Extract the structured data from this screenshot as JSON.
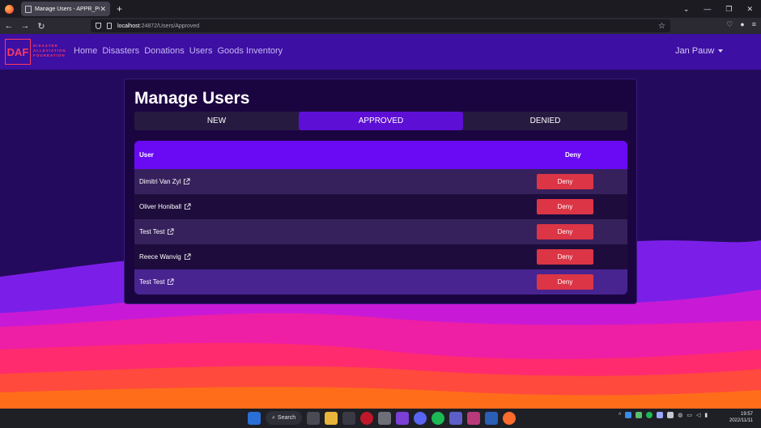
{
  "browser": {
    "tab_title": "Manage Users - APPR_POE",
    "tab_close": "✕",
    "new_tab": "+",
    "url_host": "localhost",
    "url_path": ":24872/Users/Approved",
    "window_controls": [
      "⌄",
      "—",
      "❐",
      "✕"
    ],
    "nav_buttons": [
      "←",
      "→",
      "↻"
    ],
    "toolbar_icons": [
      "shield-icon",
      "account-icon",
      "menu-icon"
    ]
  },
  "site": {
    "logo_text": "DAF",
    "logo_sub": [
      "DISASTER",
      "ALLEVIATION",
      "FOUNDATION"
    ],
    "menu": [
      "Home",
      "Disasters",
      "Donations",
      "Users",
      "Goods Inventory"
    ],
    "user_name": "Jan Pauw"
  },
  "page": {
    "title": "Manage Users",
    "tabs": [
      {
        "label": "NEW",
        "active": false
      },
      {
        "label": "APPROVED",
        "active": true
      },
      {
        "label": "DENIED",
        "active": false
      }
    ],
    "table": {
      "headers": {
        "user": "User",
        "action": "Deny"
      },
      "rows": [
        {
          "user": "Dimitri Van Zyl",
          "action": "Deny"
        },
        {
          "user": "Oliver Honiball",
          "action": "Deny"
        },
        {
          "user": "Test Test",
          "action": "Deny"
        },
        {
          "user": "Reece Wanvig",
          "action": "Deny"
        },
        {
          "user": "Test Test",
          "action": "Deny"
        }
      ]
    }
  },
  "taskbar": {
    "search_label": "Search",
    "clock_time": "19:57",
    "clock_date": "2022/11/11"
  },
  "colors": {
    "nav_bg": "#3d0fa3",
    "active_tab": "#5d0fd6",
    "table_header": "#6a0af5",
    "deny_button": "#dc3545",
    "logo_accent": "#ff3b5c"
  }
}
